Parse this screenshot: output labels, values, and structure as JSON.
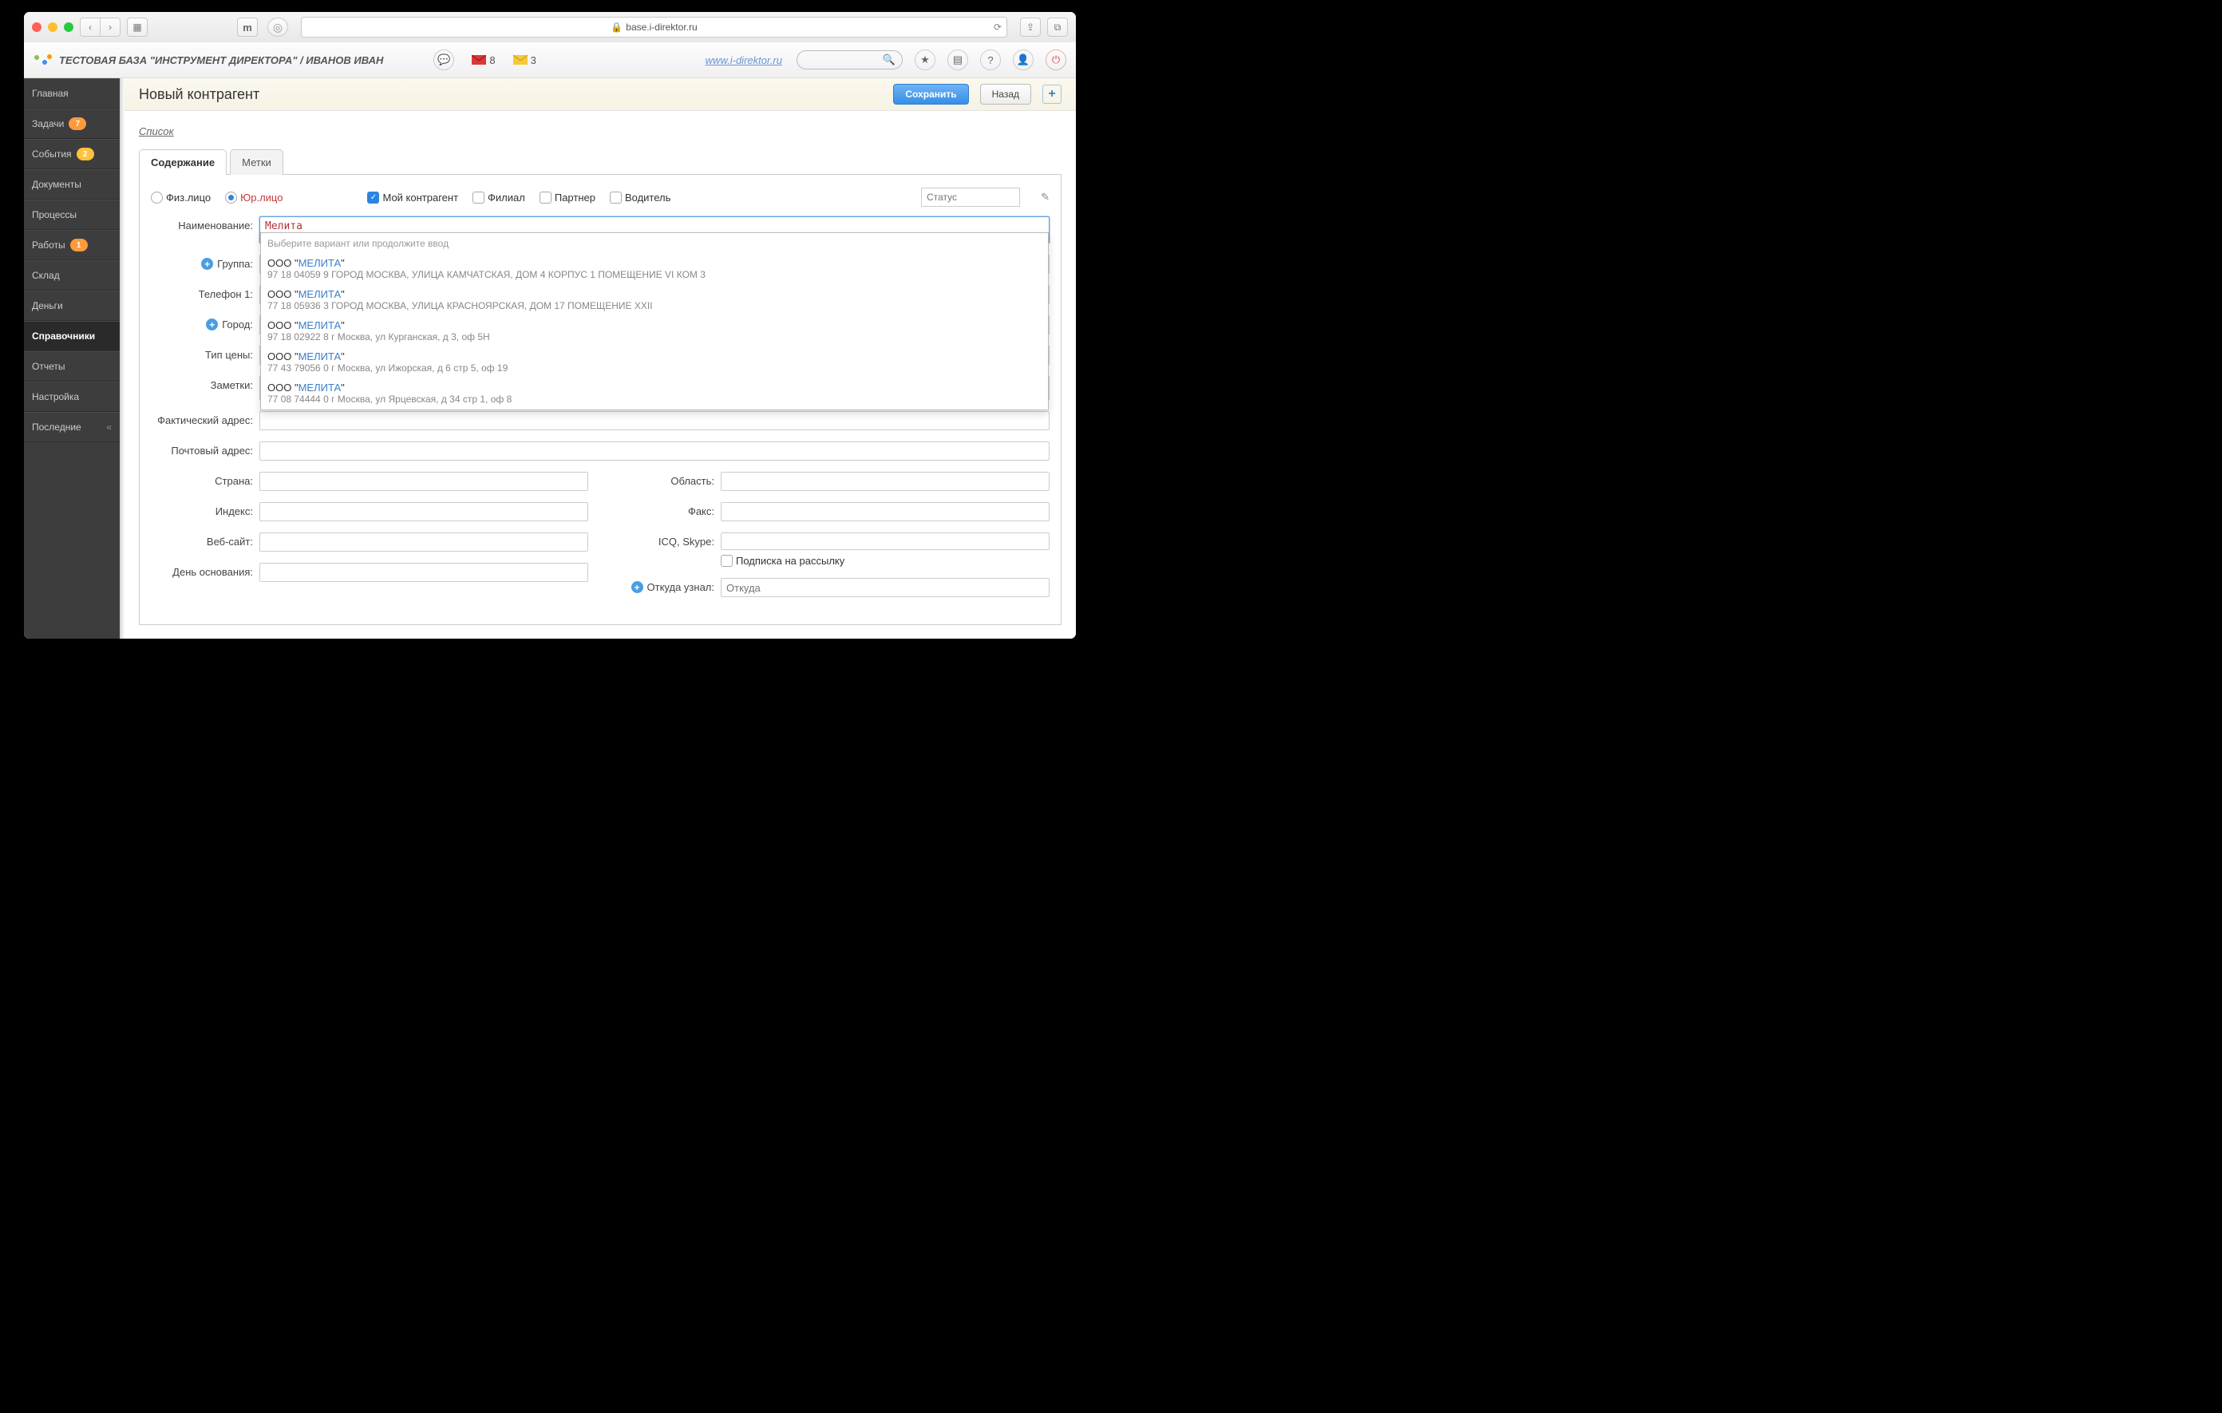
{
  "browser": {
    "url": "base.i-direktor.ru"
  },
  "topbar": {
    "brand": "ТЕСТОВАЯ БАЗА \"ИНСТРУМЕНТ ДИРЕКТОРА\" / ИВАНОВ ИВАН",
    "mail_red": "8",
    "mail_yellow": "3",
    "promo_link": "www.i-direktor.ru"
  },
  "sidebar": {
    "items": [
      {
        "label": "Главная",
        "badge": null
      },
      {
        "label": "Задачи",
        "badge": "7"
      },
      {
        "label": "События",
        "badge": "2",
        "yellow": true
      },
      {
        "label": "Документы",
        "badge": null
      },
      {
        "label": "Процессы",
        "badge": null
      },
      {
        "label": "Работы",
        "badge": "1"
      },
      {
        "label": "Склад",
        "badge": null
      },
      {
        "label": "Деньги",
        "badge": null
      },
      {
        "label": "Справочники",
        "badge": null,
        "active": true
      },
      {
        "label": "Отчеты",
        "badge": null
      },
      {
        "label": "Настройка",
        "badge": null
      },
      {
        "label": "Последние",
        "badge": null,
        "chev": true
      }
    ]
  },
  "header": {
    "title": "Новый контрагент",
    "save": "Сохранить",
    "back": "Назад",
    "list_link": "Список"
  },
  "tabs": {
    "content": "Содержание",
    "tags": "Метки"
  },
  "form": {
    "radios": {
      "individual": "Физ.лицо",
      "legal": "Юр.лицо"
    },
    "checks": {
      "mine": "Мой контрагент",
      "branch": "Филиал",
      "partner": "Партнер",
      "driver": "Водитель"
    },
    "status_placeholder": "Статус",
    "labels": {
      "name": "Наименование:",
      "group": "Группа:",
      "phone1": "Телефон 1:",
      "city": "Город:",
      "pricetype": "Тип цены:",
      "notes": "Заметки:",
      "actual_addr": "Фактический адрес:",
      "postal_addr": "Почтовый адрес:",
      "country": "Страна:",
      "index": "Индекс:",
      "website": "Веб-сайт:",
      "founding": "День основания:",
      "region": "Область:",
      "fax": "Факс:",
      "icq": "ICQ, Skype:",
      "newsletter": "Подписка на рассылку",
      "source": "Откуда узнал:",
      "source_placeholder": "Откуда"
    },
    "name_value": "Мелита"
  },
  "suggest": {
    "title": "Выберите вариант или продолжите ввод",
    "items": [
      {
        "prefix": "ООО \"",
        "match": "МЕЛИТА",
        "suffix": "\"",
        "addr": "97 18 04059 9  ГОРОД МОСКВА, УЛИЦА КАМЧАТСКАЯ, ДОМ 4 КОРПУС 1 ПОМЕЩЕНИЕ VI КОМ 3"
      },
      {
        "prefix": "ООО \"",
        "match": "МЕЛИТА",
        "suffix": "\"",
        "addr": "77 18 05936 3  ГОРОД МОСКВА, УЛИЦА КРАСНОЯРСКАЯ, ДОМ 17 ПОМЕЩЕНИЕ XXII"
      },
      {
        "prefix": "ООО \"",
        "match": "МЕЛИТА",
        "suffix": "\"",
        "addr": "97 18 02922 8  г Москва, ул Курганская, д 3, оф 5Н"
      },
      {
        "prefix": "ООО \"",
        "match": "МЕЛИТА",
        "suffix": "\"",
        "addr": "77 43 79056 0  г Москва, ул Ижорская, д 6 стр 5, оф 19"
      },
      {
        "prefix": "ООО \"",
        "match": "МЕЛИТА",
        "suffix": "\"",
        "addr": "77 08 74444 0  г Москва, ул Ярцевская, д 34 стр 1, оф 8"
      }
    ]
  }
}
